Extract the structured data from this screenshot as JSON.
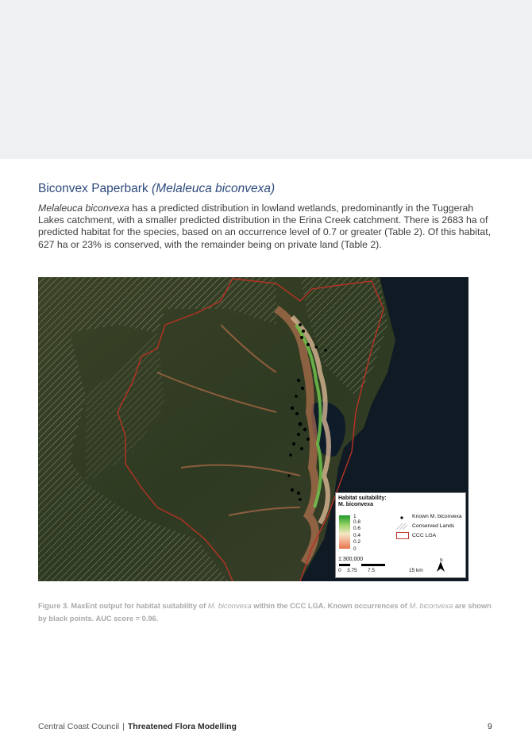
{
  "section": {
    "title_plain": "Biconvex Paperbark",
    "title_italic": "(Melaleuca biconvexa)"
  },
  "paragraph": {
    "species": "Melaleuca biconvexa",
    "text_1": " has a predicted distribution in lowland wetlands, predominantly in the Tuggerah Lakes catchment, with a smaller predicted distribution in the Erina Creek catchment. There is 2683 ha of predicted habitat for the species, based on an occurrence level of 0.7 or greater (Table 2). Of this habitat, 627 ha or 23% is conserved, with the remainder being on private land (Table 2)."
  },
  "map": {
    "legend": {
      "title_line1": "Habitat suitability:",
      "title_line2": "M. biconvexa",
      "gradient_labels": [
        "1",
        "0.8",
        "0.6",
        "0.4",
        "0.2",
        "0"
      ],
      "items": [
        {
          "label": "Known M. biconvexa",
          "symbol": "black-dot"
        },
        {
          "label": "Conserved Lands",
          "symbol": "hatched-box"
        },
        {
          "label": "CCC LGA",
          "symbol": "red-outline-box"
        }
      ],
      "scale_ratio": "1:300,000",
      "scale_labels": [
        "0",
        "3.75",
        "7.5",
        "15 km"
      ],
      "north_label": "N",
      "colors": {
        "high": "#1f9a2a",
        "mid": "#f2e7c4",
        "low": "#e8734a",
        "lga": "#c0392b"
      }
    }
  },
  "caption": {
    "part1": "Figure 3. MaxEnt output for habitat suitability of ",
    "species1": "M. biconvexa",
    "part2": " within the CCC LGA. Known occurrences of ",
    "species2": "M. biconvexa",
    "part3": " are shown by black points. AUC score = 0.96."
  },
  "footer": {
    "org": "Central Coast Council",
    "separator": "|",
    "report": "Threatened Flora Modelling",
    "page": "9"
  }
}
